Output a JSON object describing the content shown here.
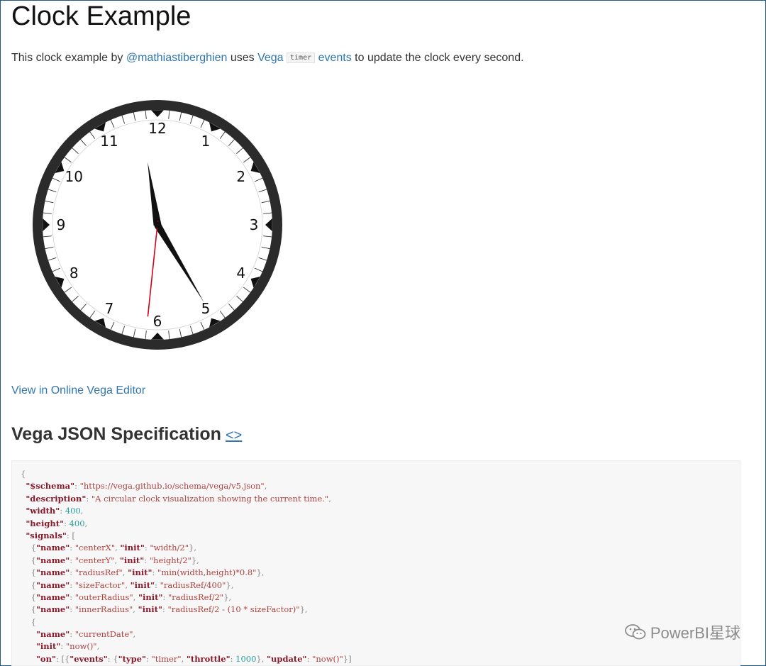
{
  "page": {
    "title": "Clock Example",
    "intro": {
      "text_before": "This clock example by ",
      "author_link": "@mathiastiberghien",
      "text_uses": " uses ",
      "vega_link": "Vega",
      "timer_code": "timer",
      "events_link": "events",
      "text_after": " to update the clock every second."
    },
    "editor_link": "View in Online Vega Editor",
    "spec_heading": "Vega JSON Specification",
    "spec_anchor": "<>"
  },
  "clock": {
    "numerals": [
      "12",
      "1",
      "2",
      "3",
      "4",
      "5",
      "6",
      "7",
      "8",
      "9",
      "10",
      "11"
    ],
    "time": {
      "hour": 4,
      "minute": 58,
      "second": 31
    },
    "colors": {
      "rim": "#2b2b2b",
      "face": "#ffffff",
      "hands": "#111111",
      "second_hand": "#d0021b"
    }
  },
  "code": [
    [
      [
        "p",
        "{"
      ]
    ],
    [
      [
        "p",
        "  "
      ],
      [
        "k",
        "\"$schema\""
      ],
      [
        "p",
        ": "
      ],
      [
        "s",
        "\"https://vega.github.io/schema/vega/v5.json\""
      ],
      [
        "p",
        ","
      ]
    ],
    [
      [
        "p",
        "  "
      ],
      [
        "k",
        "\"description\""
      ],
      [
        "p",
        ": "
      ],
      [
        "s",
        "\"A circular clock visualization showing the current time.\""
      ],
      [
        "p",
        ","
      ]
    ],
    [
      [
        "p",
        "  "
      ],
      [
        "k",
        "\"width\""
      ],
      [
        "p",
        ": "
      ],
      [
        "n",
        "400"
      ],
      [
        "p",
        ","
      ]
    ],
    [
      [
        "p",
        "  "
      ],
      [
        "k",
        "\"height\""
      ],
      [
        "p",
        ": "
      ],
      [
        "n",
        "400"
      ],
      [
        "p",
        ","
      ]
    ],
    [
      [
        "p",
        "  "
      ],
      [
        "k",
        "\"signals\""
      ],
      [
        "p",
        ": ["
      ]
    ],
    [
      [
        "p",
        "    {"
      ],
      [
        "k",
        "\"name\""
      ],
      [
        "p",
        ": "
      ],
      [
        "s",
        "\"centerX\""
      ],
      [
        "p",
        ", "
      ],
      [
        "k",
        "\"init\""
      ],
      [
        "p",
        ": "
      ],
      [
        "s",
        "\"width/2\""
      ],
      [
        "p",
        "},"
      ]
    ],
    [
      [
        "p",
        "    {"
      ],
      [
        "k",
        "\"name\""
      ],
      [
        "p",
        ": "
      ],
      [
        "s",
        "\"centerY\""
      ],
      [
        "p",
        ", "
      ],
      [
        "k",
        "\"init\""
      ],
      [
        "p",
        ": "
      ],
      [
        "s",
        "\"height/2\""
      ],
      [
        "p",
        "},"
      ]
    ],
    [
      [
        "p",
        "    {"
      ],
      [
        "k",
        "\"name\""
      ],
      [
        "p",
        ": "
      ],
      [
        "s",
        "\"radiusRef\""
      ],
      [
        "p",
        ", "
      ],
      [
        "k",
        "\"init\""
      ],
      [
        "p",
        ": "
      ],
      [
        "s",
        "\"min(width,height)*0.8\""
      ],
      [
        "p",
        "},"
      ]
    ],
    [
      [
        "p",
        "    {"
      ],
      [
        "k",
        "\"name\""
      ],
      [
        "p",
        ": "
      ],
      [
        "s",
        "\"sizeFactor\""
      ],
      [
        "p",
        ", "
      ],
      [
        "k",
        "\"init\""
      ],
      [
        "p",
        ": "
      ],
      [
        "s",
        "\"radiusRef/400\""
      ],
      [
        "p",
        "},"
      ]
    ],
    [
      [
        "p",
        "    {"
      ],
      [
        "k",
        "\"name\""
      ],
      [
        "p",
        ": "
      ],
      [
        "s",
        "\"outerRadius\""
      ],
      [
        "p",
        ", "
      ],
      [
        "k",
        "\"init\""
      ],
      [
        "p",
        ": "
      ],
      [
        "s",
        "\"radiusRef/2\""
      ],
      [
        "p",
        "},"
      ]
    ],
    [
      [
        "p",
        "    {"
      ],
      [
        "k",
        "\"name\""
      ],
      [
        "p",
        ": "
      ],
      [
        "s",
        "\"innerRadius\""
      ],
      [
        "p",
        ", "
      ],
      [
        "k",
        "\"init\""
      ],
      [
        "p",
        ": "
      ],
      [
        "s",
        "\"radiusRef/2 - (10 * sizeFactor)\""
      ],
      [
        "p",
        "},"
      ]
    ],
    [
      [
        "p",
        "    {"
      ]
    ],
    [
      [
        "p",
        "      "
      ],
      [
        "k",
        "\"name\""
      ],
      [
        "p",
        ": "
      ],
      [
        "s",
        "\"currentDate\""
      ],
      [
        "p",
        ","
      ]
    ],
    [
      [
        "p",
        "      "
      ],
      [
        "k",
        "\"init\""
      ],
      [
        "p",
        ": "
      ],
      [
        "s",
        "\"now()\""
      ],
      [
        "p",
        ","
      ]
    ],
    [
      [
        "p",
        "      "
      ],
      [
        "k",
        "\"on\""
      ],
      [
        "p",
        ": [{"
      ],
      [
        "k",
        "\"events\""
      ],
      [
        "p",
        ": {"
      ],
      [
        "k",
        "\"type\""
      ],
      [
        "p",
        ": "
      ],
      [
        "s",
        "\"timer\""
      ],
      [
        "p",
        ", "
      ],
      [
        "k",
        "\"throttle\""
      ],
      [
        "p",
        ": "
      ],
      [
        "n",
        "1000"
      ],
      [
        "p",
        "}, "
      ],
      [
        "k",
        "\"update\""
      ],
      [
        "p",
        ": "
      ],
      [
        "s",
        "\"now()\""
      ],
      [
        "p",
        "}]"
      ]
    ]
  ],
  "watermark": {
    "text": "PowerBI星球",
    "icon": "wechat-icon"
  }
}
